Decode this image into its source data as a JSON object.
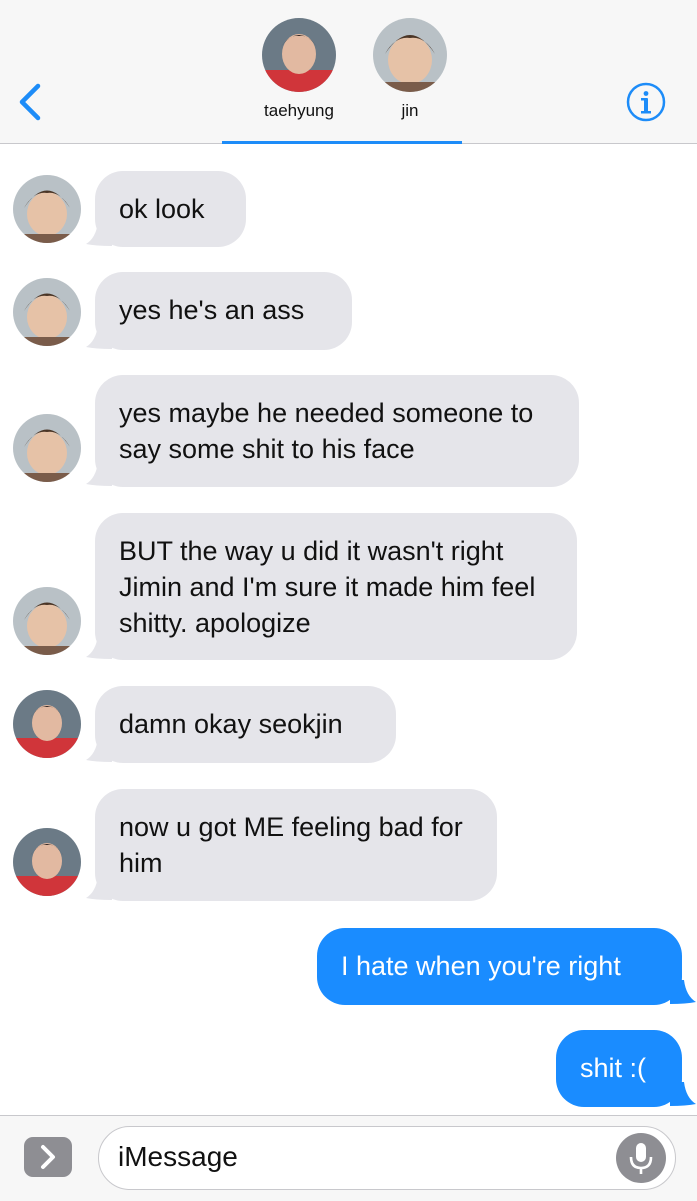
{
  "header": {
    "participants": [
      {
        "name": "taehyung"
      },
      {
        "name": "jin"
      }
    ],
    "back_icon": "chevron-left-icon",
    "info_icon": "info-icon",
    "accent": "#1d8cf8"
  },
  "messages": [
    {
      "sender": "jin",
      "direction": "incoming",
      "text": "ok look"
    },
    {
      "sender": "jin",
      "direction": "incoming",
      "text": "yes he's an ass"
    },
    {
      "sender": "jin",
      "direction": "incoming",
      "text": "yes maybe he needed someone to say some shit to his face"
    },
    {
      "sender": "jin",
      "direction": "incoming",
      "text": "BUT the way u did it wasn't right Jimin and I'm sure it made him feel shitty. apologize"
    },
    {
      "sender": "taehyung",
      "direction": "incoming",
      "text": "damn okay seokjin"
    },
    {
      "sender": "taehyung",
      "direction": "incoming",
      "text": "now u got ME feeling bad for him"
    },
    {
      "sender": "me",
      "direction": "outgoing",
      "text": "I hate when you're right"
    },
    {
      "sender": "me",
      "direction": "outgoing",
      "text": "shit :("
    }
  ],
  "composer": {
    "placeholder": "iMessage",
    "apps_icon": "chevron-right-icon",
    "mic_icon": "microphone-icon"
  },
  "colors": {
    "incoming_bubble": "#e5e5ea",
    "outgoing_bubble": "#1a8cff"
  }
}
